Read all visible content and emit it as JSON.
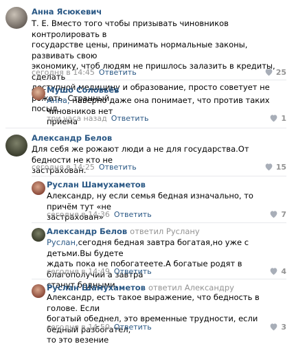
{
  "colors": {
    "link": "#2a5885",
    "meta": "#939393",
    "divider": "#e7e8ec",
    "text": "#000000"
  },
  "comments": [
    {
      "author": "Анна Ясюкевич",
      "lines": [
        "Т. Е. Вместо того чтобы призывать чиновников контролировать в",
        "государстве цены, принимать нормальные законы, развивать свою",
        "экономику, чтоб людям не пришлось залазить в кредиты, сделать",
        "доступной медицину и образование, просто советует не рожать. Странный",
        "посыл"
      ],
      "time": "сегодня в 14:45",
      "reply": "Ответить",
      "likes": "25"
    },
    {
      "author": "Мушо Соловьёв",
      "mention": "Анна,",
      "lines": [
        " наверно даже она понимает, что против таких чиновников нет",
        "приема"
      ],
      "time": "три часа назад",
      "reply": "Ответить",
      "likes": "1"
    },
    {
      "author": "Александр Белов",
      "lines": [
        "Для себя же рожают люди а не для государства.От бедности не кто не",
        "застрахован."
      ],
      "time": "сегодня в 14:25",
      "reply": "Ответить",
      "likes": "15"
    },
    {
      "author": "Руслан Шамухаметов",
      "lines": [
        "Александр, ну если семья бедная изначально, то причём тут «не",
        "застрахован»"
      ],
      "time": "сегодня в 14:36",
      "reply": "Ответить",
      "likes": "7"
    },
    {
      "author": "Александр Белов",
      "replied": "ответил Руслану",
      "mention": "Руслан,",
      "lines": [
        "сегодня бедная завтра богатая,но уже с детьми.Вы будете",
        "ждать пока не побогатеете.А богатые родят в благополучии а завтра",
        "станут бедными."
      ],
      "time": "сегодня в 14:49",
      "reply": "Ответить",
      "likes": "4"
    },
    {
      "author": "Руслан Шамухаметов",
      "replied": "ответил Александру",
      "lines": [
        "Александр, есть такое выражение, что бедность в голове. Если",
        "богатый обеднел, это временные трудности, если бедный разбогател,",
        "то это везение"
      ],
      "time": "сегодня в 14:50",
      "reply": "Ответить",
      "likes": "3"
    }
  ]
}
